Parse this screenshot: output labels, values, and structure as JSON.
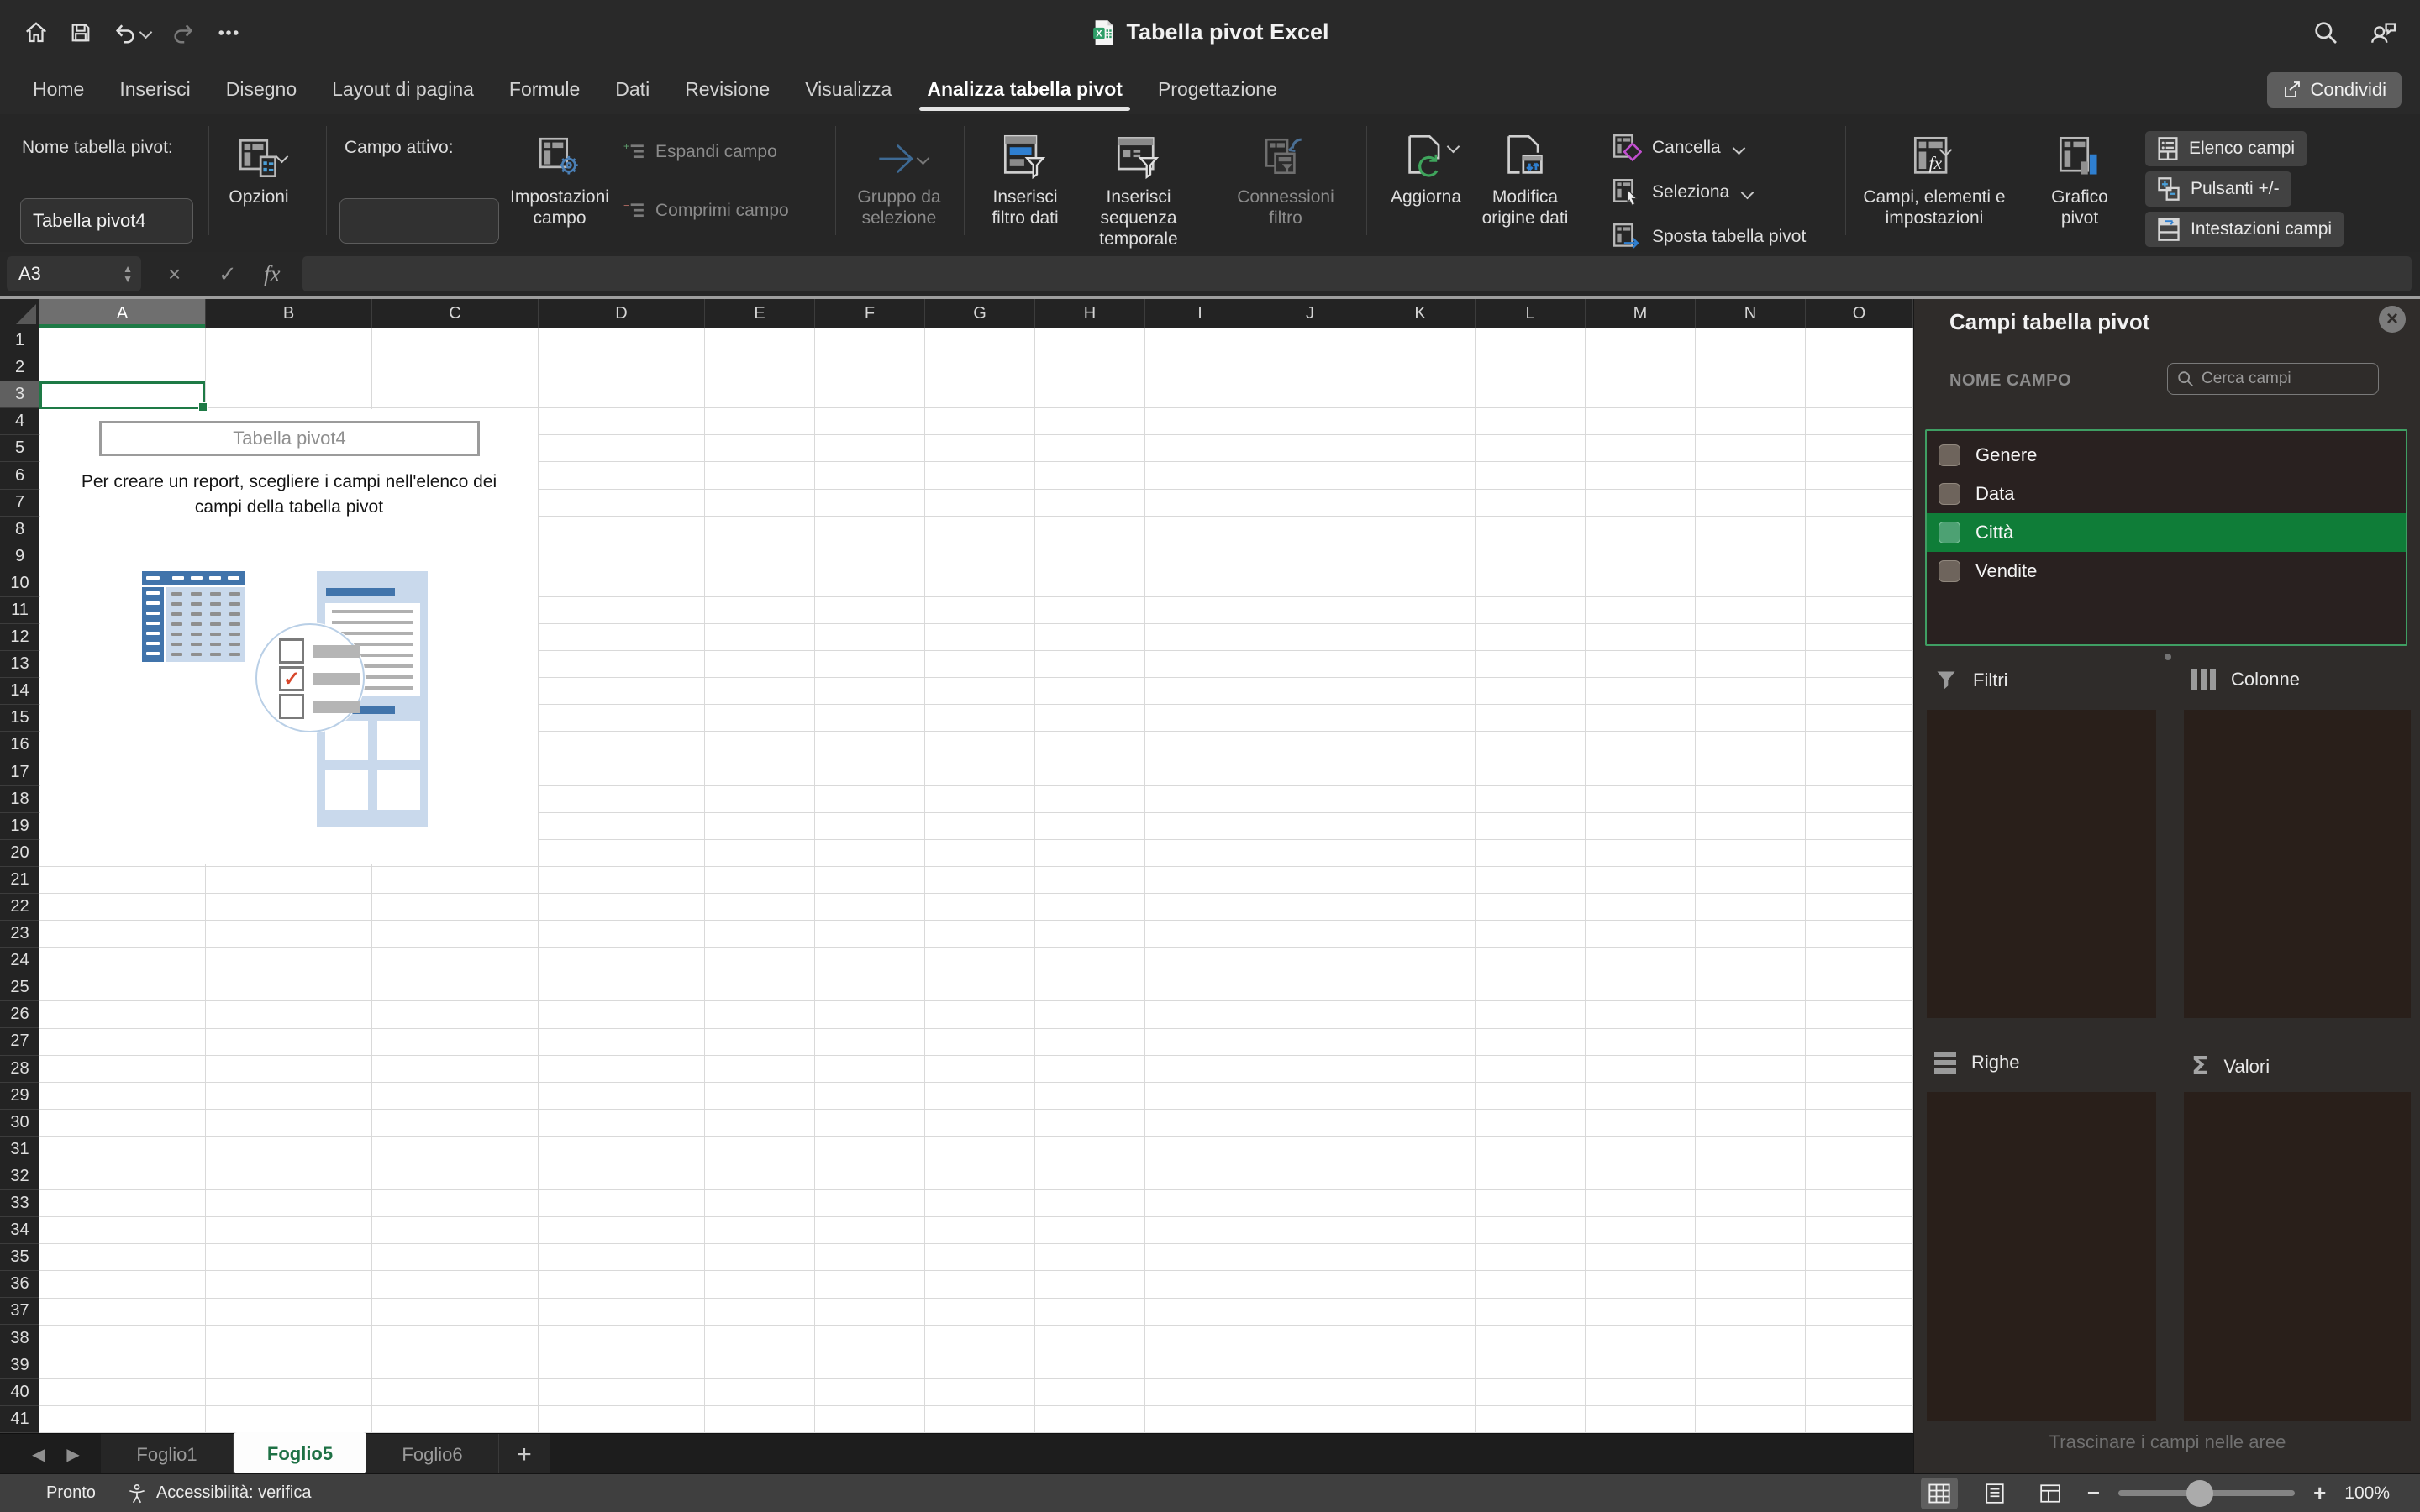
{
  "titlebar": {
    "title": "Tabella pivot Excel"
  },
  "tabs": [
    "Home",
    "Inserisci",
    "Disegno",
    "Layout di pagina",
    "Formule",
    "Dati",
    "Revisione",
    "Visualizza",
    "Analizza tabella pivot",
    "Progettazione"
  ],
  "active_tab": "Analizza tabella pivot",
  "share_label": "Condividi",
  "ribbon": {
    "pivot_name_label": "Nome tabella pivot:",
    "pivot_name_value": "Tabella pivot4",
    "options_label": "Opzioni",
    "active_field_label": "Campo attivo:",
    "active_field_value": "",
    "field_settings_label": "Impostazioni campo",
    "expand_label": "Espandi campo",
    "collapse_label": "Comprimi campo",
    "group_selection_label": "Gruppo da selezione",
    "insert_slicer_label": "Inserisci filtro dati",
    "insert_timeline_label": "Inserisci sequenza temporale",
    "filter_connections_label": "Connessioni filtro",
    "refresh_label": "Aggiorna",
    "change_source_label": "Modifica origine dati",
    "clear_label": "Cancella",
    "select_label": "Seleziona",
    "move_label": "Sposta tabella pivot",
    "fields_items_label": "Campi, elementi e impostazioni",
    "pivot_chart_label": "Grafico pivot",
    "field_list_label": "Elenco campi",
    "plus_minus_label": "Pulsanti +/-",
    "field_headers_label": "Intestazioni campi"
  },
  "formula_bar": {
    "cell_ref": "A3",
    "formula": ""
  },
  "grid": {
    "columns": [
      "A",
      "B",
      "C",
      "D",
      "E",
      "F",
      "G",
      "H",
      "I",
      "J",
      "K",
      "L",
      "M",
      "N",
      "O"
    ],
    "rows": 41,
    "selected_cell": "A3",
    "selected_column": "A",
    "selected_row": 3
  },
  "placeholder": {
    "title": "Tabella pivot4",
    "line1": "Per creare un report, scegliere i campi nell'elenco dei",
    "line2": "campi della tabella pivot"
  },
  "fields_panel": {
    "title": "Campi tabella pivot",
    "name_header": "NOME CAMPO",
    "search_placeholder": "Cerca campi",
    "fields": [
      {
        "label": "Genere",
        "checked": false,
        "highlighted": false
      },
      {
        "label": "Data",
        "checked": false,
        "highlighted": false
      },
      {
        "label": "Città",
        "checked": false,
        "highlighted": true
      },
      {
        "label": "Vendite",
        "checked": false,
        "highlighted": false
      }
    ],
    "areas": {
      "filters": "Filtri",
      "columns": "Colonne",
      "rows": "Righe",
      "values": "Valori"
    },
    "hint": "Trascinare i campi nelle aree"
  },
  "sheet_tabs": {
    "tabs": [
      "Foglio1",
      "Foglio5",
      "Foglio6"
    ],
    "active": "Foglio5"
  },
  "status_bar": {
    "ready": "Pronto",
    "accessibility": "Accessibilità: verifica",
    "zoom": "100%"
  },
  "colors": {
    "excel_green": "#1e7a46",
    "selection_green": "#0f7d38",
    "list_border_green": "#3f9e63",
    "accent_blue": "#4174ab",
    "refresh_green": "#3fa45c",
    "clear_magenta": "#c24fd0",
    "check_red": "#d8472b"
  }
}
